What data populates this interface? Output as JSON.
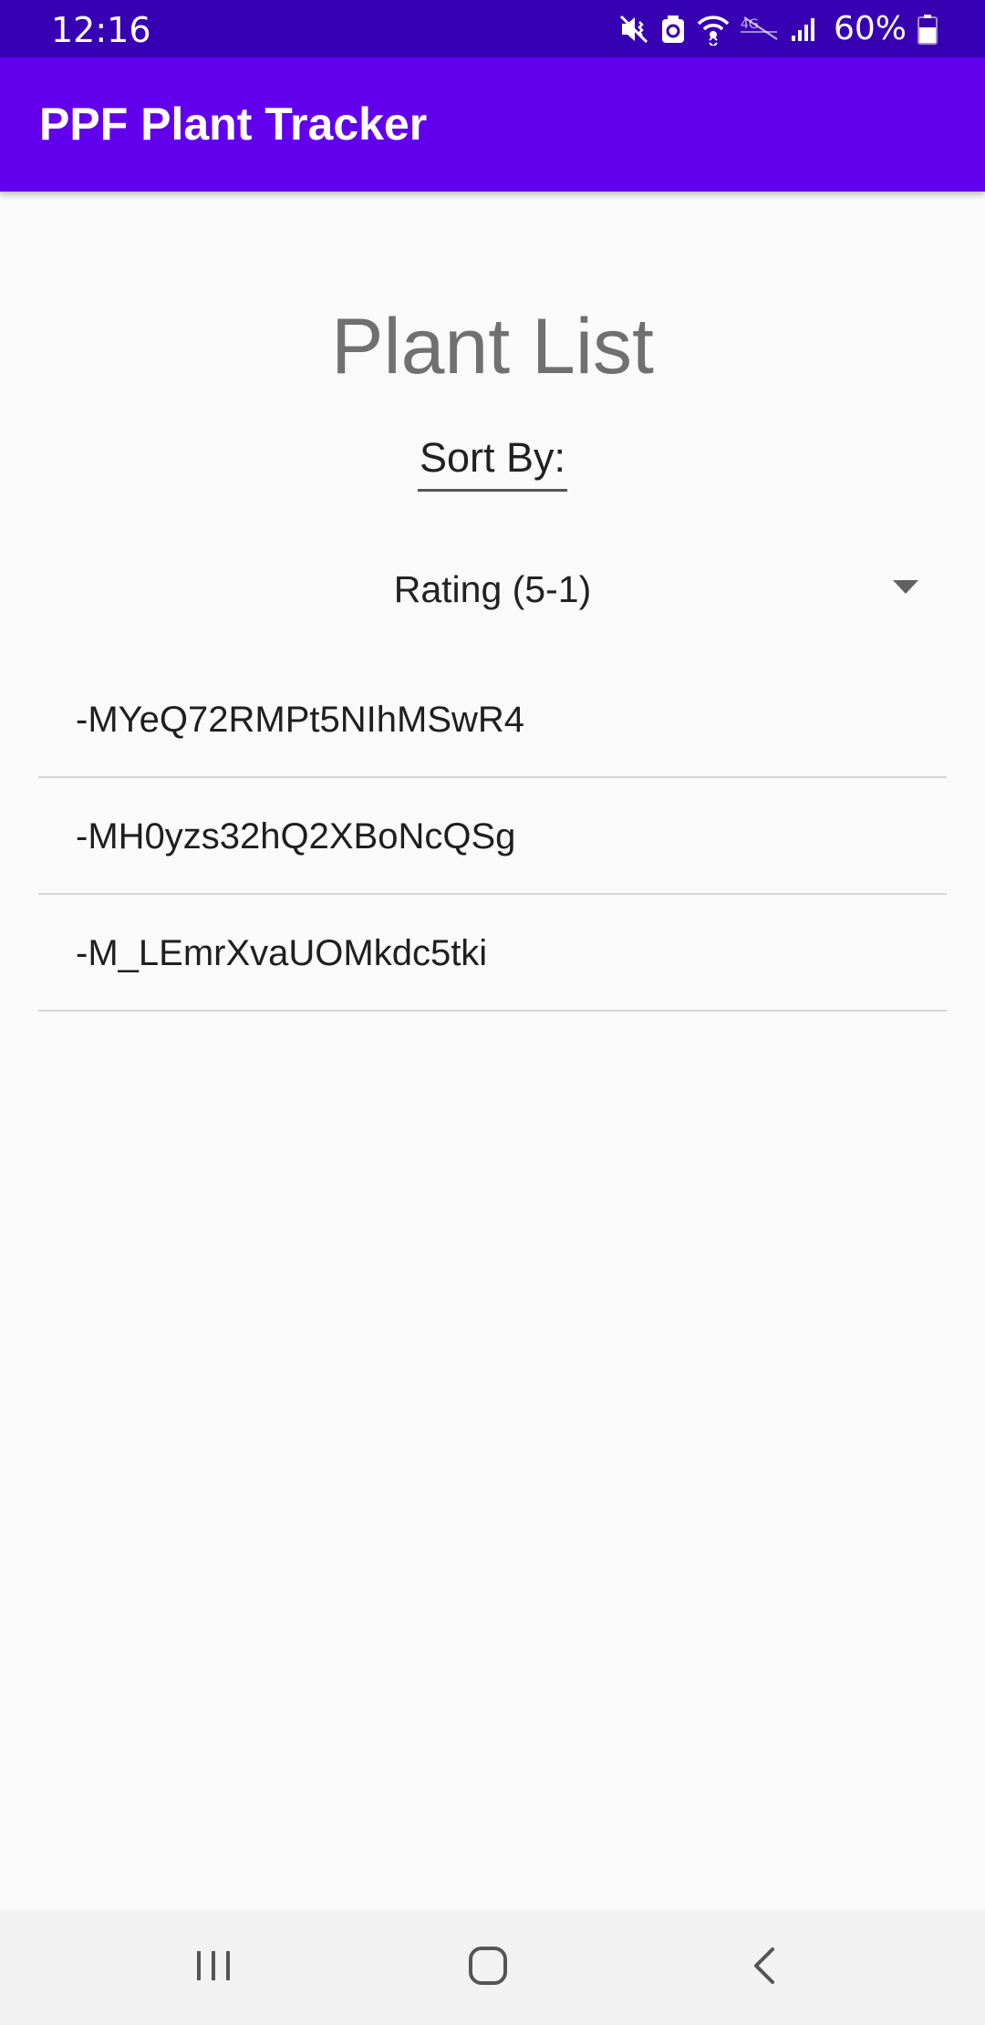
{
  "status_bar": {
    "time": "12:16",
    "battery": "60%",
    "icons": [
      "mute-vibrate-icon",
      "data-saver-icon",
      "wifi-icon",
      "volte-icon",
      "signal-icon",
      "battery-icon"
    ]
  },
  "app_bar": {
    "title": "PPF Plant Tracker",
    "color": "#6200ee"
  },
  "main": {
    "page_title": "Plant List",
    "sort_label": "Sort By:",
    "sort_select": {
      "selected": "Rating (5-1)"
    },
    "plants": [
      {
        "id": "-MYeQ72RMPt5NIhMSwR4"
      },
      {
        "id": "-MH0yzs32hQ2XBoNcQSg"
      },
      {
        "id": "-M_LEmrXvaUOMkdc5tki"
      }
    ]
  },
  "nav_bar": {
    "buttons": [
      "recent-apps-icon",
      "home-icon",
      "back-icon"
    ]
  },
  "colors": {
    "status_bar": "#3700b3",
    "primary": "#6200ee",
    "background": "#fafafa"
  }
}
